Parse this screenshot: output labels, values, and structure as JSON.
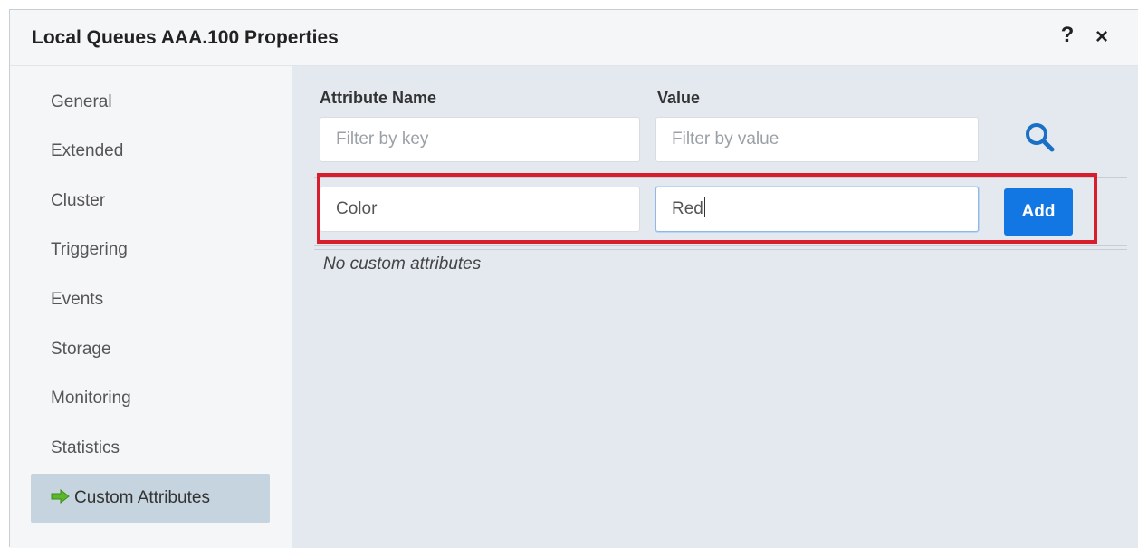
{
  "dialog": {
    "title": "Local Queues AAA.100 Properties",
    "help_label": "?",
    "close_label": "×"
  },
  "sidebar": {
    "items": [
      {
        "label": "General"
      },
      {
        "label": "Extended"
      },
      {
        "label": "Cluster"
      },
      {
        "label": "Triggering"
      },
      {
        "label": "Events"
      },
      {
        "label": "Storage"
      },
      {
        "label": "Monitoring"
      },
      {
        "label": "Statistics"
      },
      {
        "label": "Custom Attributes",
        "active": true
      }
    ]
  },
  "filters": {
    "attribute_name_label": "Attribute Name",
    "value_label": "Value",
    "key_placeholder": "Filter by key",
    "value_placeholder": "Filter by value"
  },
  "new_attribute": {
    "key_value": "Color",
    "value_value": "Red",
    "add_label": "Add"
  },
  "empty_message": "No custom attributes",
  "colors": {
    "accent": "#1277e3",
    "highlight": "#d81e2c",
    "active_nav": "#c5d4de",
    "arrow": "#5cb82a"
  }
}
